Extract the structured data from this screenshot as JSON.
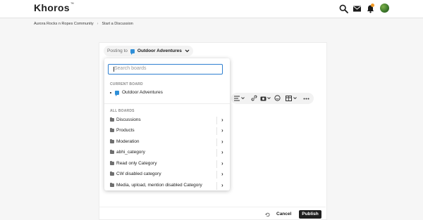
{
  "app": {
    "logo_text": "Khoros",
    "trademark": "™"
  },
  "header_icons": [
    "search-icon",
    "mail-icon",
    "bell-icon",
    "avatar"
  ],
  "breadcrumb": {
    "items": [
      "Aurora Rocks n Ropes Community",
      "Start a Discussion"
    ],
    "separator": "›"
  },
  "posting": {
    "label": "Posting to",
    "board": "Outdoor Adventures"
  },
  "dropdown": {
    "search_placeholder": "Search boards",
    "current_label": "CURRENT BOARD",
    "current_board": "Outdoor Adventures",
    "all_label": "ALL BOARDS",
    "boards": [
      "Discussions",
      "Products",
      "Moderation",
      "abhi_category",
      "Read only Category",
      "CW disabled category",
      "Media, upload, mention disabled Category"
    ]
  },
  "footer": {
    "cancel_label": "Cancel",
    "publish_label": "Publish"
  },
  "colors": {
    "accent": "#2f7fd0",
    "notification": "#f29a26",
    "publish_bg": "#1f1f1f"
  }
}
